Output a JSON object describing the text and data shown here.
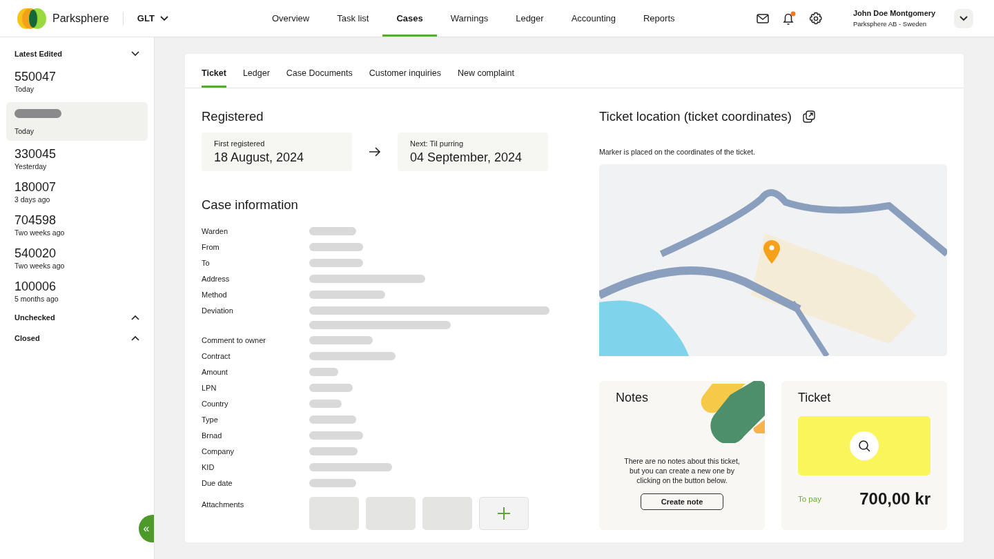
{
  "header": {
    "brand": "Parksphere",
    "org_selector": "GLT",
    "nav": [
      {
        "label": "Overview",
        "selected": false
      },
      {
        "label": "Task list",
        "selected": false
      },
      {
        "label": "Cases",
        "selected": true
      },
      {
        "label": "Warnings",
        "selected": false
      },
      {
        "label": "Ledger",
        "selected": false
      },
      {
        "label": "Accounting",
        "selected": false
      },
      {
        "label": "Reports",
        "selected": false
      }
    ],
    "notifications_unread": true,
    "user": {
      "name": "John Doe Montgomery",
      "company": "Parksphere AB - Sweden"
    }
  },
  "sidebar": {
    "sections": [
      {
        "title": "Latest Edited",
        "expanded": true,
        "items": [
          {
            "number": "550047",
            "time": "Today",
            "selected": false
          },
          {
            "time": "Today",
            "selected": true
          },
          {
            "number": "330045",
            "time": "Yesterday",
            "selected": false
          },
          {
            "number": "180007",
            "time": "3 days ago",
            "selected": false
          },
          {
            "number": "704598",
            "time": "Two weeks ago",
            "selected": false
          },
          {
            "number": "540020",
            "time": "Two weeks ago",
            "selected": false
          },
          {
            "number": "100006",
            "time": "5 months ago",
            "selected": false
          }
        ]
      },
      {
        "title": "Unchecked",
        "expanded": false
      },
      {
        "title": "Closed",
        "expanded": false
      }
    ],
    "collapse_button": "«"
  },
  "tabs": [
    {
      "label": "Ticket",
      "selected": true
    },
    {
      "label": "Ledger",
      "selected": false
    },
    {
      "label": "Case Documents",
      "selected": false
    },
    {
      "label": "Customer inquiries",
      "selected": false
    },
    {
      "label": "New complaint",
      "selected": false
    }
  ],
  "registered": {
    "title": "Registered",
    "first": {
      "label": "First registered",
      "date": "18 August, 2024"
    },
    "next": {
      "label": "Next: Til purring",
      "date": "04 September, 2024"
    }
  },
  "case_information": {
    "title": "Case information",
    "fields": [
      "Warden",
      "From",
      "To",
      "Address",
      "Method",
      "Deviation",
      "Comment to owner",
      "Contract",
      "Amount",
      "LPN",
      "Country",
      "Type",
      "Brnad",
      "Company",
      "KID",
      "Due date"
    ],
    "attachments_label": "Attachments"
  },
  "location": {
    "title": "Ticket location (ticket coordinates)",
    "caption": "Marker is placed on the coordinates of the ticket."
  },
  "notes": {
    "title": "Notes",
    "message": "There are no notes about this ticket, but you can create a new one by clicking on the button below.",
    "button": "Create note"
  },
  "ticket": {
    "title": "Ticket",
    "to_pay_label": "To pay",
    "amount": "700,00 kr"
  }
}
